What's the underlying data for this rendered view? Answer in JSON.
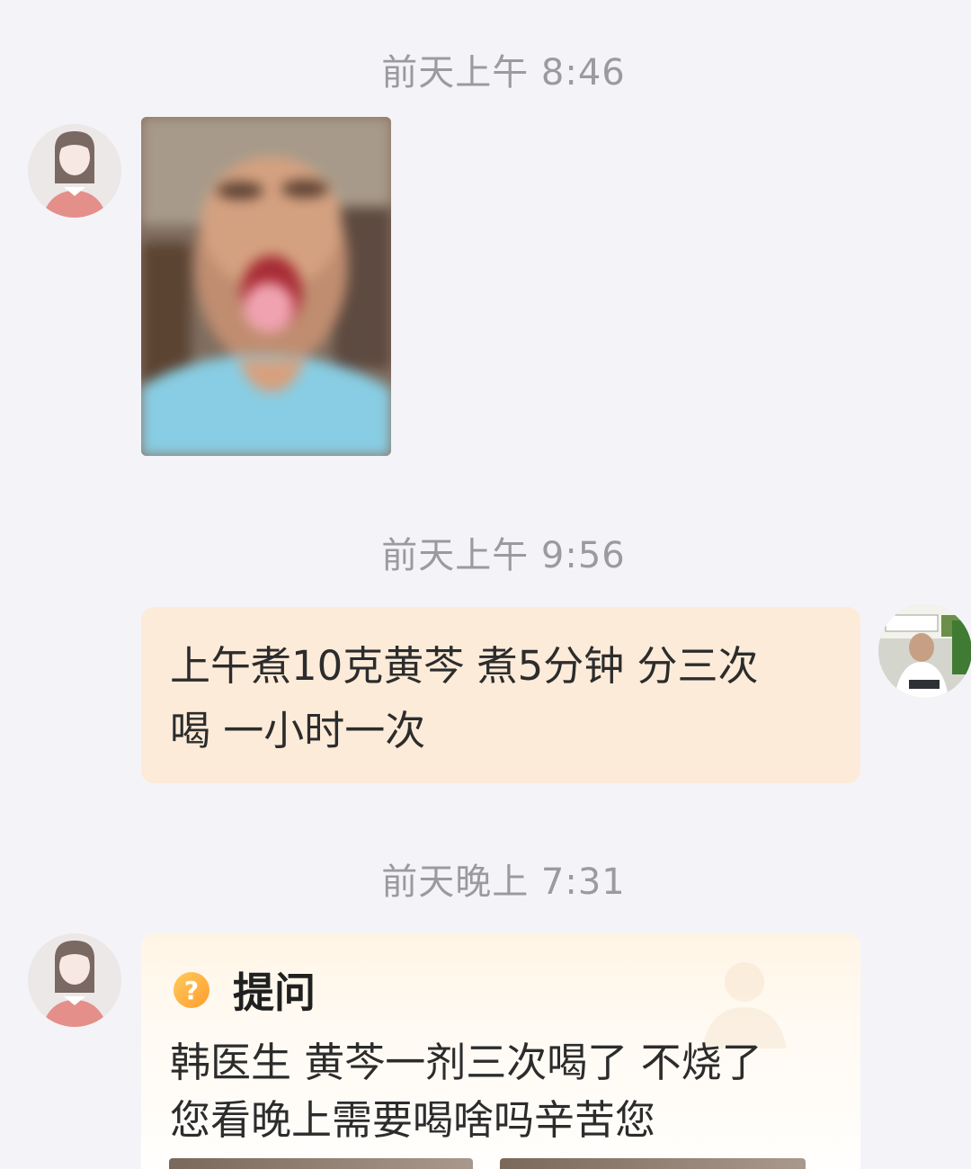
{
  "timestamps": {
    "first": "前天上午 8:46",
    "second": "前天上午 9:56",
    "third": "前天晚上 7:31"
  },
  "messages": {
    "reply_text_line1": "上午煮10克黄芩 煮5分钟 分三次",
    "reply_text_line2": "喝 一小时一次"
  },
  "question": {
    "badge": "?",
    "title": "提问",
    "line1": "韩医生 黄芩一剂三次喝了 不烧了",
    "line2": "您看晚上需要喝啥吗辛苦您"
  },
  "icons": {
    "patient_avatar": "patient-avatar-icon",
    "doctor_avatar": "doctor-avatar-icon",
    "question_badge": "question-mark-icon"
  },
  "colors": {
    "background": "#f4f4f8",
    "reply_bubble": "#fdebd9",
    "timestamp": "#9a9a9f",
    "badge": "#ff9c2f"
  }
}
